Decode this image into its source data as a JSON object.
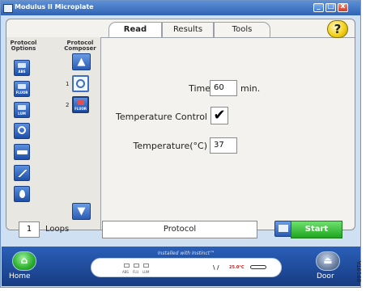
{
  "window": {
    "title": "Modulus II Microplate",
    "buttons": {
      "minimize": "_",
      "maximize": "□",
      "close": "x"
    }
  },
  "tabs": [
    {
      "label": "Read",
      "active": true
    },
    {
      "label": "Results",
      "active": false
    },
    {
      "label": "Tools",
      "active": false
    }
  ],
  "help": {
    "label": "?"
  },
  "left_panel": {
    "options_header": "Protocol Options",
    "composer_header": "Protocol Composer",
    "options": [
      {
        "icon": "absorbance-icon",
        "label": "ABS"
      },
      {
        "icon": "fluorescence-icon",
        "label": "FLUOR"
      },
      {
        "icon": "luminescence-icon",
        "label": "LUM"
      },
      {
        "icon": "clock-icon",
        "label": ""
      },
      {
        "icon": "shake-icon",
        "label": ""
      },
      {
        "icon": "kinetic-icon",
        "label": ""
      },
      {
        "icon": "inject-icon",
        "label": ""
      }
    ],
    "composer_steps": [
      {
        "number": "1",
        "icon": "clock-icon",
        "label": ""
      },
      {
        "number": "2",
        "icon": "fluorescence-icon",
        "label": "FLUOR"
      }
    ],
    "arrows": {
      "up": "▲",
      "down": "▼"
    }
  },
  "form": {
    "time_label": "Time",
    "time_value": "60",
    "time_unit": "min.",
    "temp_control_label": "Temperature Control",
    "temp_control_checked": "✔",
    "temperature_label": "Temperature(°C)",
    "temperature_value": "37"
  },
  "bottom": {
    "loops_value": "1",
    "loops_label": "Loops",
    "protocol_label": "Protocol",
    "start_label": "Start"
  },
  "footer": {
    "home_label": "Home",
    "door_label": "Door",
    "installed_label": "Installed with Instinct™",
    "mini_labels": [
      "ABS",
      "FLU",
      "LUM"
    ],
    "temp_indicator": "25.0°C"
  },
  "side_code": "8919TA",
  "colors": {
    "title_bar": "#2f63b3",
    "start_green": "#1fa61f",
    "footer_blue": "#173c82",
    "help_yellow": "#f2d21a"
  }
}
